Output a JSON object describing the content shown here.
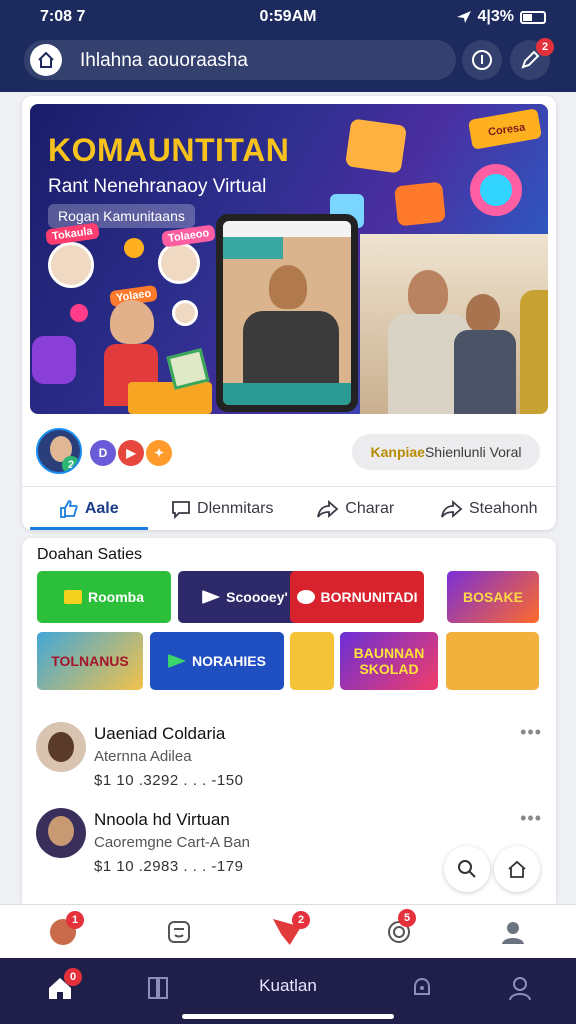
{
  "status_bar": {
    "time_left": "7:08 7",
    "time_center": "0:59AM",
    "battery": "4|3%"
  },
  "url_bar": {
    "text": "Ihlahna aouoraasha",
    "notif_badge": "2"
  },
  "hero": {
    "title": "KOMAUNTITAN",
    "subtitle": "Rant Nenehranaoy Virtual",
    "pill": "Rogan Kamunitaans",
    "stickers": [
      "Tokaula",
      "Tolaeoo",
      "Yolaeo",
      "Coresa"
    ]
  },
  "card": {
    "avatar_badge": "2",
    "promo": {
      "accent": "Kanpiae",
      "rest": " Shienlunli Voral"
    },
    "actions": [
      {
        "label": "Aale",
        "icon": "thumbs-up-icon"
      },
      {
        "label": "Dlenmitars",
        "icon": "comment-icon"
      },
      {
        "label": "Charar",
        "icon": "share-icon"
      },
      {
        "label": "Steahonh",
        "icon": "forward-icon"
      }
    ]
  },
  "section": {
    "title": "Doahan Saties",
    "tiles": [
      "Roomba",
      "Scoooey'",
      "BORNUNITADI",
      "BOSAKE",
      "TOLNANUS",
      "NORAHIES",
      "",
      "BAUNNAN SKOLAD",
      ""
    ]
  },
  "list": [
    {
      "name": "Uaeniad Coldaria",
      "sub": "Aternna Adilea",
      "meta": "$1 10  .3292  . . . -150"
    },
    {
      "name": "Nnoola hd Virtuan",
      "sub": "Caoremgne Cart-A Ban",
      "meta": "$1 10  .2983  . . . -179"
    }
  ],
  "tray_badges": [
    "1",
    "2",
    "5"
  ],
  "nav": {
    "home_badge": "0",
    "center_label": "Kuatlan"
  },
  "colors": {
    "brand_dark": "#1c2a5e",
    "accent_blue": "#1b7de0",
    "badge_red": "#e5313c",
    "hero_yellow": "#f7c21b"
  }
}
